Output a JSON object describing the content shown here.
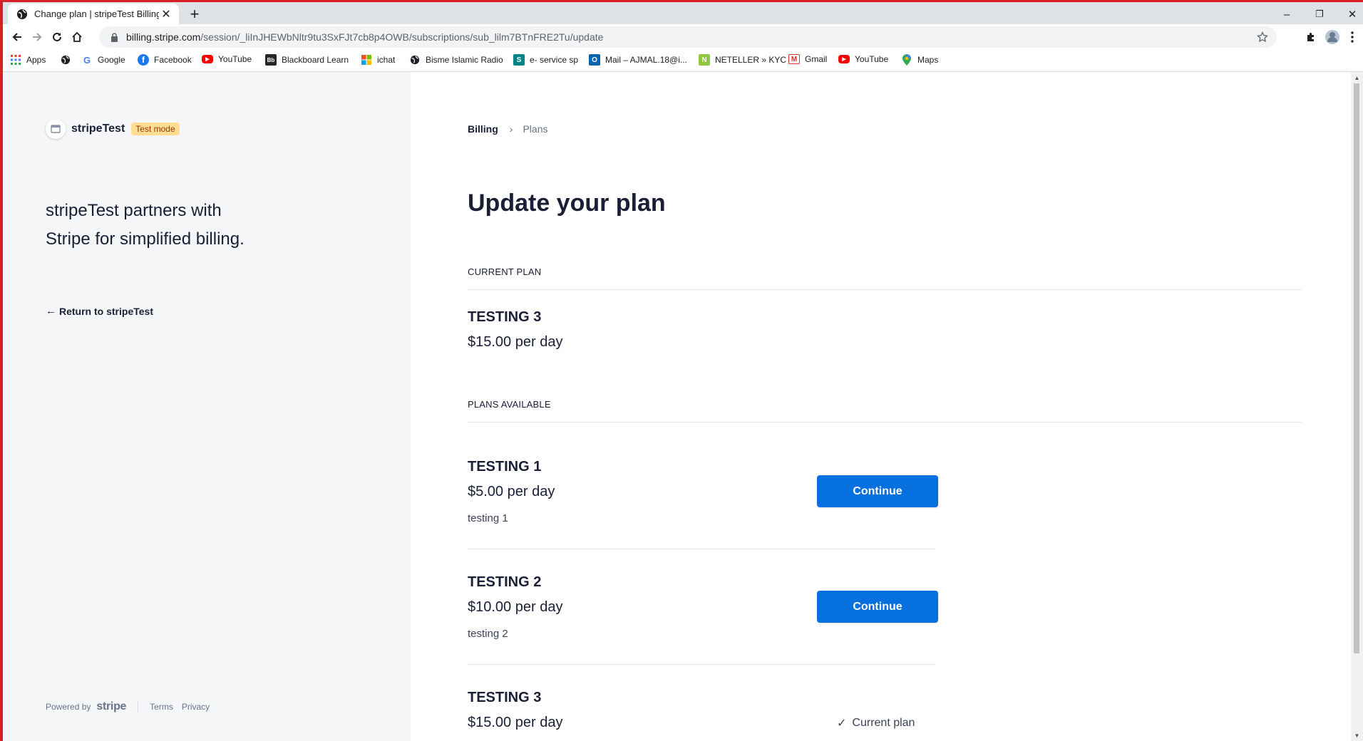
{
  "browser": {
    "tab_title": "Change plan | stripeTest Billing",
    "close_glyph": "✕",
    "new_tab_glyph": "+",
    "url_domain": "billing.stripe.com",
    "url_path": "/session/_liInJHEWbNltr9tu3SxFJt7cb8p4OWB/subscriptions/sub_lilm7BTnFRE2Tu/update",
    "window_controls": [
      "–",
      "❐",
      "✕"
    ],
    "bookmarks": [
      {
        "label": "Apps",
        "icon": "apps-grid-icon"
      },
      {
        "label": "",
        "icon": "globe-icon"
      },
      {
        "label": "Google",
        "icon": "google-icon",
        "color": "#4285f4",
        "glyph": "G"
      },
      {
        "label": "Facebook",
        "icon": "facebook-icon",
        "color": "#1877f2",
        "glyph": "f"
      },
      {
        "label": "YouTube",
        "icon": "youtube-icon",
        "color": "#ff0000",
        "glyph": "▶"
      },
      {
        "label": "Blackboard Learn",
        "icon": "blackboard-icon",
        "color": "#262626",
        "glyph": "Bb"
      },
      {
        "label": "ichat",
        "icon": "windows-icon"
      },
      {
        "label": "Bisme Islamic Radio",
        "icon": "globe-icon"
      },
      {
        "label": "e- service sp",
        "icon": "sharepoint-icon",
        "color": "#038387",
        "glyph": "S"
      },
      {
        "label": "Mail – AJMAL.18@i...",
        "icon": "outlook-icon",
        "color": "#0a64ad",
        "glyph": "O"
      },
      {
        "label": "NETELLER » KYC",
        "icon": "neteller-icon",
        "color": "#8dc63f",
        "glyph": "N"
      },
      {
        "label": "Gmail",
        "icon": "gmail-icon",
        "color": "#d93025",
        "glyph": "M"
      },
      {
        "label": "YouTube",
        "icon": "youtube-icon",
        "color": "#ff0000",
        "glyph": "▶"
      },
      {
        "label": "Maps",
        "icon": "maps-pin-icon",
        "color": "#34a853",
        "glyph": "●"
      }
    ]
  },
  "sidebar": {
    "brand_name": "stripeTest",
    "test_mode": "Test mode",
    "tagline": "stripeTest partners with Stripe for simplified billing.",
    "return_arrow": "←",
    "return_label": "Return to stripeTest",
    "powered_by": "Powered by",
    "stripe_word": "stripe",
    "terms": "Terms",
    "privacy": "Privacy"
  },
  "main": {
    "breadcrumb_billing": "Billing",
    "breadcrumb_sep": "›",
    "breadcrumb_plans": "Plans",
    "title": "Update your plan",
    "current_plan_label": "CURRENT PLAN",
    "current_plan": {
      "name": "TESTING 3",
      "price": "$15.00 per day"
    },
    "plans_available_label": "PLANS AVAILABLE",
    "plans": [
      {
        "name": "TESTING 1",
        "price": "$5.00 per day",
        "description": "testing 1",
        "action": "Continue"
      },
      {
        "name": "TESTING 2",
        "price": "$10.00 per day",
        "description": "testing 2",
        "action": "Continue"
      },
      {
        "name": "TESTING 3",
        "price": "$15.00 per day",
        "description": "",
        "action": "Current plan"
      }
    ],
    "current_check": "✓"
  },
  "colors": {
    "primary_button": "#0570de",
    "test_mode_bg": "#ffde92",
    "test_mode_text": "#983705",
    "sidebar_bg": "#f5f6f8",
    "window_frame": "#d71f26"
  }
}
